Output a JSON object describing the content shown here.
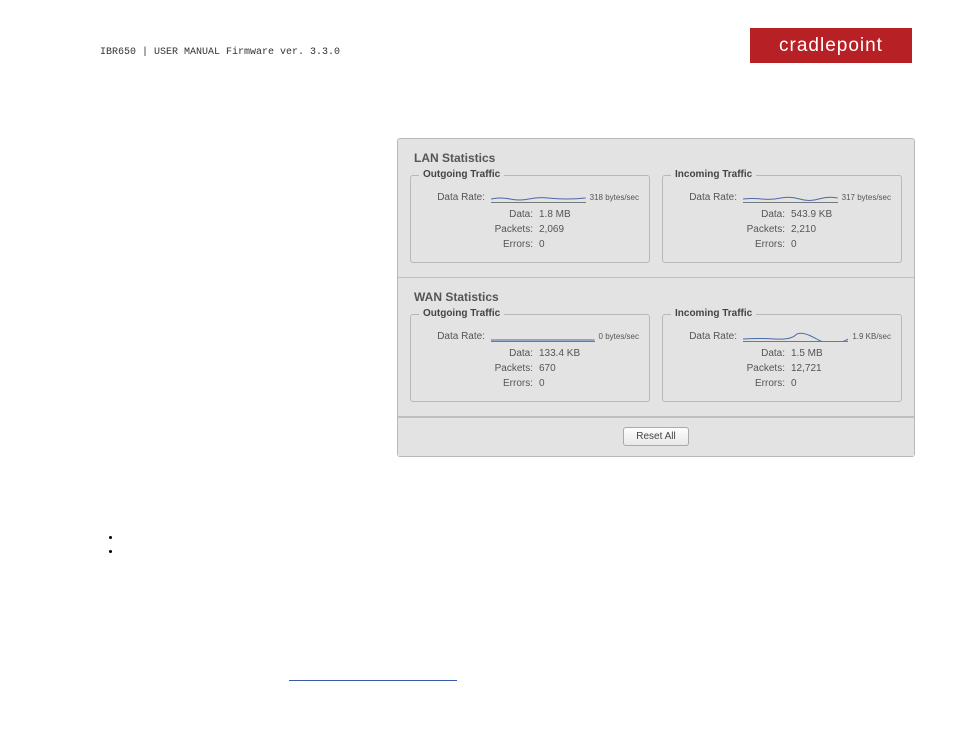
{
  "header": {
    "title": "IBR650 | USER MANUAL Firmware ver. 3.3.0",
    "logo_text": "cradlepoint"
  },
  "bullets": {
    "items": [
      "",
      ""
    ]
  },
  "panel": {
    "lan": {
      "title": "LAN Statistics",
      "outgoing": {
        "legend": "Outgoing Traffic",
        "rate_label": "Data Rate:",
        "rate_value": "318 bytes/sec",
        "data_label": "Data:",
        "data_value": "1.8 MB",
        "packets_label": "Packets:",
        "packets_value": "2,069",
        "errors_label": "Errors:",
        "errors_value": "0"
      },
      "incoming": {
        "legend": "Incoming Traffic",
        "rate_label": "Data Rate:",
        "rate_value": "317 bytes/sec",
        "data_label": "Data:",
        "data_value": "543.9 KB",
        "packets_label": "Packets:",
        "packets_value": "2,210",
        "errors_label": "Errors:",
        "errors_value": "0"
      }
    },
    "wan": {
      "title": "WAN Statistics",
      "outgoing": {
        "legend": "Outgoing Traffic",
        "rate_label": "Data Rate:",
        "rate_value": "0 bytes/sec",
        "data_label": "Data:",
        "data_value": "133.4 KB",
        "packets_label": "Packets:",
        "packets_value": "670",
        "errors_label": "Errors:",
        "errors_value": "0"
      },
      "incoming": {
        "legend": "Incoming Traffic",
        "rate_label": "Data Rate:",
        "rate_value": "1.9 KB/sec",
        "data_label": "Data:",
        "data_value": "1.5 MB",
        "packets_label": "Packets:",
        "packets_value": "12,721",
        "errors_label": "Errors:",
        "errors_value": "0"
      }
    },
    "reset_label": "Reset All"
  }
}
